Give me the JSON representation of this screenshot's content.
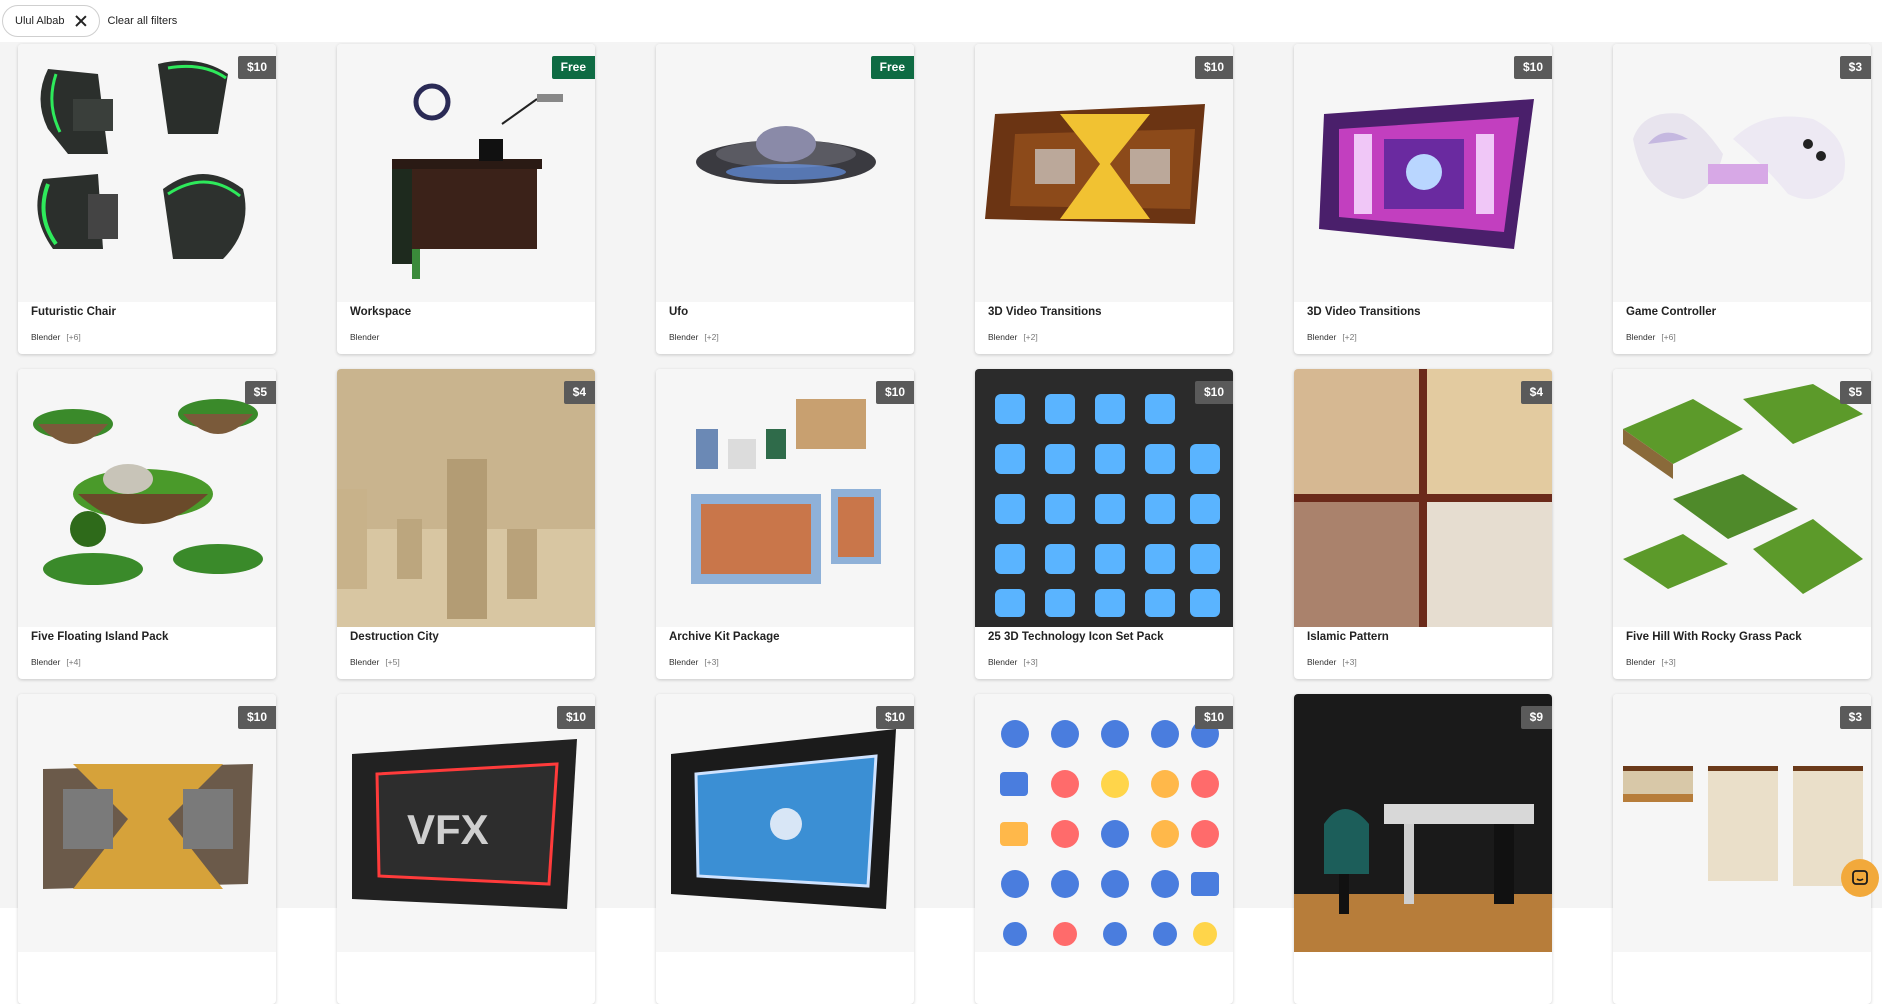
{
  "filters": {
    "chip_label": "Ulul Albab",
    "clear_label": "Clear all filters"
  },
  "products": [
    {
      "title": "Futuristic Chair",
      "price": "$10",
      "software": "Blender",
      "extra": "[+6]",
      "thumb": "chairs"
    },
    {
      "title": "Workspace",
      "price": "Free",
      "software": "Blender",
      "extra": "",
      "thumb": "desk"
    },
    {
      "title": "Ufo",
      "price": "Free",
      "software": "Blender",
      "extra": "[+2]",
      "thumb": "ufo"
    },
    {
      "title": "3D Video Transitions",
      "price": "$10",
      "software": "Blender",
      "extra": "[+2]",
      "thumb": "transition-gold"
    },
    {
      "title": "3D Video Transitions",
      "price": "$10",
      "software": "Blender",
      "extra": "[+2]",
      "thumb": "transition-purple"
    },
    {
      "title": "Game Controller",
      "price": "$3",
      "software": "Blender",
      "extra": "[+6]",
      "thumb": "controller"
    },
    {
      "title": "Five Floating Island Pack",
      "price": "$5",
      "software": "Blender",
      "extra": "[+4]",
      "thumb": "islands"
    },
    {
      "title": "Destruction City",
      "price": "$4",
      "software": "Blender",
      "extra": "[+5]",
      "thumb": "city"
    },
    {
      "title": "Archive Kit Package",
      "price": "$10",
      "software": "Blender",
      "extra": "[+3]",
      "thumb": "archive"
    },
    {
      "title": "25 3D Technology Icon Set Pack",
      "price": "$10",
      "software": "Blender",
      "extra": "[+3]",
      "thumb": "tech-icons"
    },
    {
      "title": "Islamic Pattern",
      "price": "$4",
      "software": "Blender",
      "extra": "[+3]",
      "thumb": "pattern"
    },
    {
      "title": "Five Hill With Rocky Grass Pack",
      "price": "$5",
      "software": "Blender",
      "extra": "[+3]",
      "thumb": "hills"
    },
    {
      "title": "",
      "price": "$10",
      "software": "",
      "extra": "",
      "thumb": "transition-gold2"
    },
    {
      "title": "",
      "price": "$10",
      "software": "",
      "extra": "",
      "thumb": "vfx"
    },
    {
      "title": "",
      "price": "$10",
      "software": "",
      "extra": "",
      "thumb": "frame-blue"
    },
    {
      "title": "",
      "price": "$10",
      "software": "",
      "extra": "",
      "thumb": "biz-icons"
    },
    {
      "title": "",
      "price": "$9",
      "software": "",
      "extra": "",
      "thumb": "gaming-room"
    },
    {
      "title": "",
      "price": "$3",
      "software": "",
      "extra": "",
      "thumb": "blinds"
    }
  ],
  "chat_icon": "chat-icon",
  "colors": {
    "free_badge": "#0e6b43",
    "price_badge": "#5a5a5a",
    "chat": "#f2a93b"
  }
}
